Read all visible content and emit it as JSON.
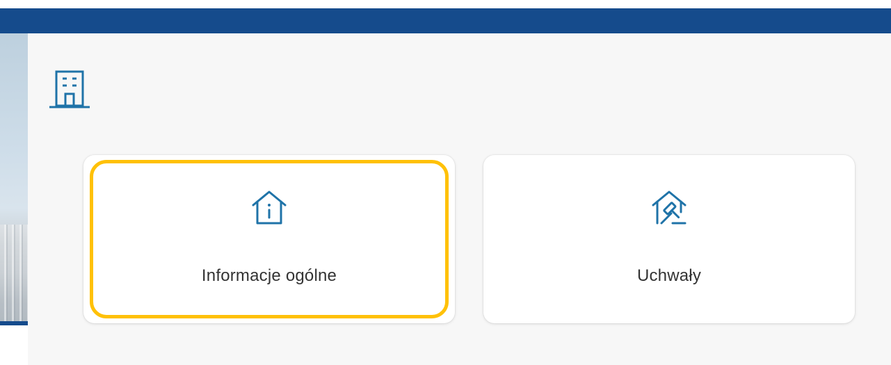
{
  "colors": {
    "top_bar": "#154b8c",
    "accent": "#1f73a8",
    "focus": "#ffc107",
    "panel_bg": "#f7f7f7",
    "card_bg": "#ffffff",
    "text": "#333333"
  },
  "header": {
    "icon": "building-icon"
  },
  "tiles": [
    {
      "label": "Informacje ogólne",
      "icon": "house-info-icon",
      "focused": true
    },
    {
      "label": "Uchwały",
      "icon": "house-gavel-icon",
      "focused": false
    }
  ]
}
